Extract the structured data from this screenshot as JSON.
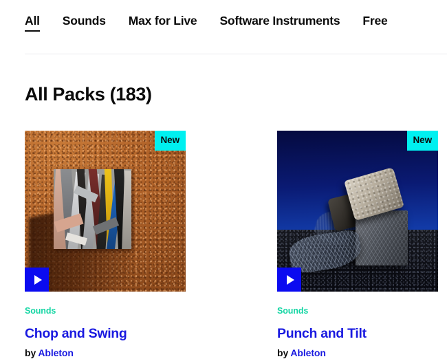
{
  "nav": {
    "items": [
      {
        "label": "All",
        "active": true
      },
      {
        "label": "Sounds",
        "active": false
      },
      {
        "label": "Max for Live",
        "active": false
      },
      {
        "label": "Software Instruments",
        "active": false
      },
      {
        "label": "Free",
        "active": false
      }
    ]
  },
  "heading": {
    "title": "All Packs (183)"
  },
  "colors": {
    "badge_new_bg": "#00f0f0",
    "badge_new_text": "#0b0b0b",
    "play_button_bg": "#0b0bf0",
    "category_text": "#15d6a4",
    "title_link": "#1a1ae0",
    "body_text": "#0b0b0b",
    "divider": "#e9eaec"
  },
  "cards": [
    {
      "badge": "New",
      "play_label": "Play preview",
      "category": "Sounds",
      "title": "Chop and Swing",
      "by_prefix": "by",
      "author": "Ableton",
      "artwork_alt": "Cube of compressed fabric and paper scraps on orange textured ground"
    },
    {
      "badge": "New",
      "play_label": "Play preview",
      "category": "Sounds",
      "title": "Punch and Tilt",
      "by_prefix": "by",
      "author": "Ableton",
      "artwork_alt": "Stacked stone and mesh blocks on dark foam against deep blue backdrop"
    }
  ]
}
